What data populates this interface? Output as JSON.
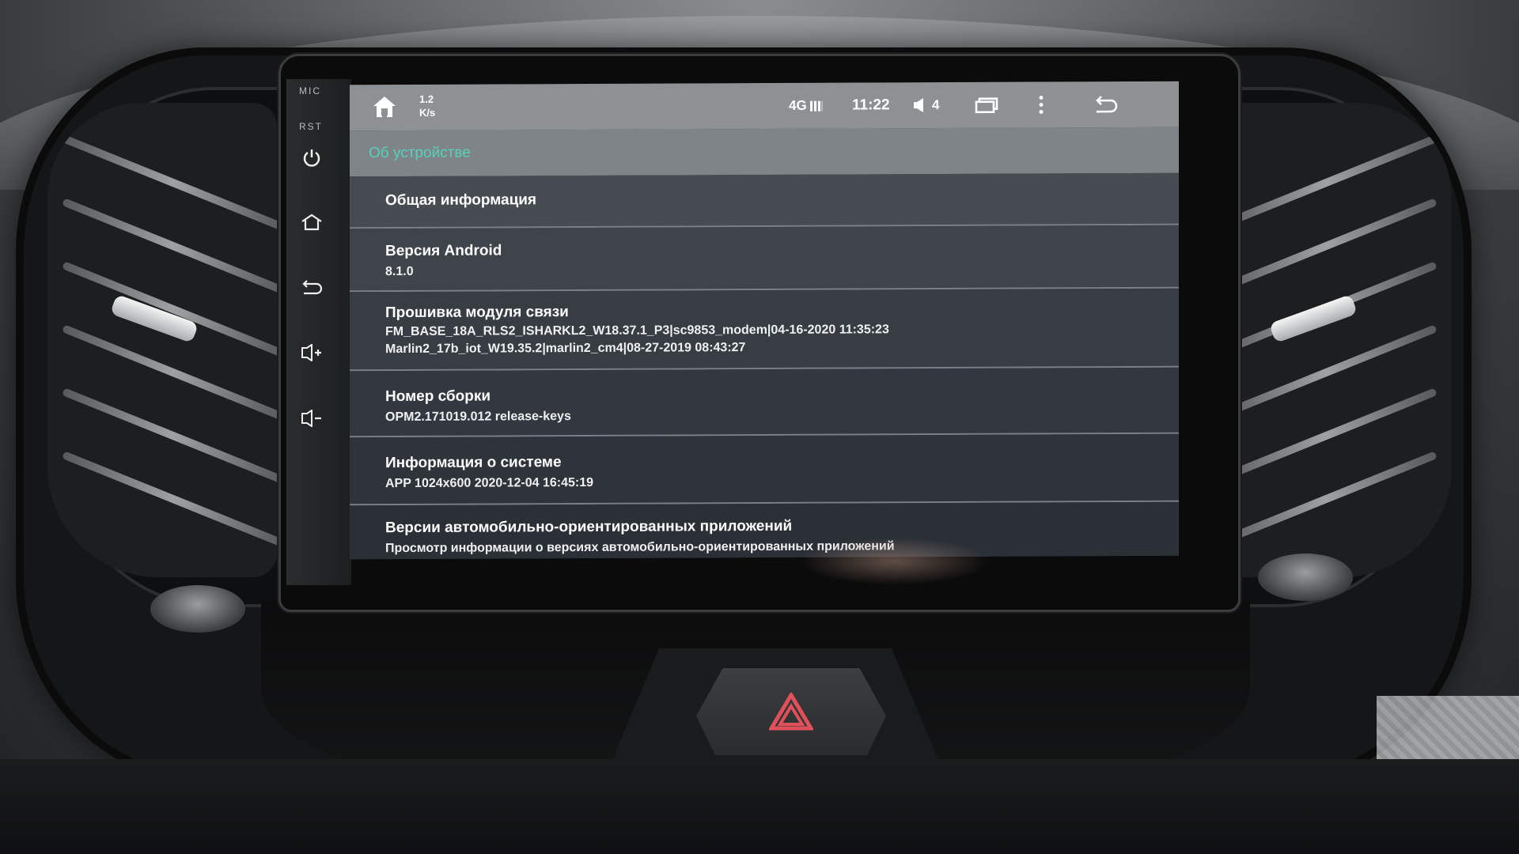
{
  "hardware": {
    "mic_label": "MIC",
    "rst_label": "RST",
    "buttons": [
      "power-icon",
      "home-icon",
      "back-icon",
      "volume-up-icon",
      "volume-down-icon"
    ]
  },
  "status_bar": {
    "net_speed_value": "1.2",
    "net_speed_unit": "K/s",
    "network": "4G",
    "time": "11:22",
    "volume": "4",
    "icons": [
      "home-icon",
      "signal-icon",
      "volume-icon",
      "recent-apps-icon",
      "more-vert-icon",
      "back-icon"
    ]
  },
  "page": {
    "title": "Об устройстве",
    "accent_color": "#56d2b8"
  },
  "items": [
    {
      "title": "Общая информация",
      "lines": []
    },
    {
      "title": "Версия Android",
      "lines": [
        "8.1.0"
      ]
    },
    {
      "title": "Прошивка модуля связи",
      "lines": [
        "FM_BASE_18A_RLS2_ISHARKL2_W18.37.1_P3|sc9853_modem|04-16-2020 11:35:23",
        "Marlin2_17b_iot_W19.35.2|marlin2_cm4|08-27-2019 08:43:27"
      ]
    },
    {
      "title": "Номер сборки",
      "lines": [
        "OPM2.171019.012 release-keys"
      ]
    },
    {
      "title": "Информация о системе",
      "lines": [
        "APP 1024x600 2020-12-04 16:45:19"
      ]
    },
    {
      "title": "Версии автомобильно-ориентированных приложений",
      "lines": [
        "Просмотр информации о версиях автомобильно-ориентированных приложений"
      ]
    }
  ],
  "hazard": {
    "color": "#e0505a"
  }
}
